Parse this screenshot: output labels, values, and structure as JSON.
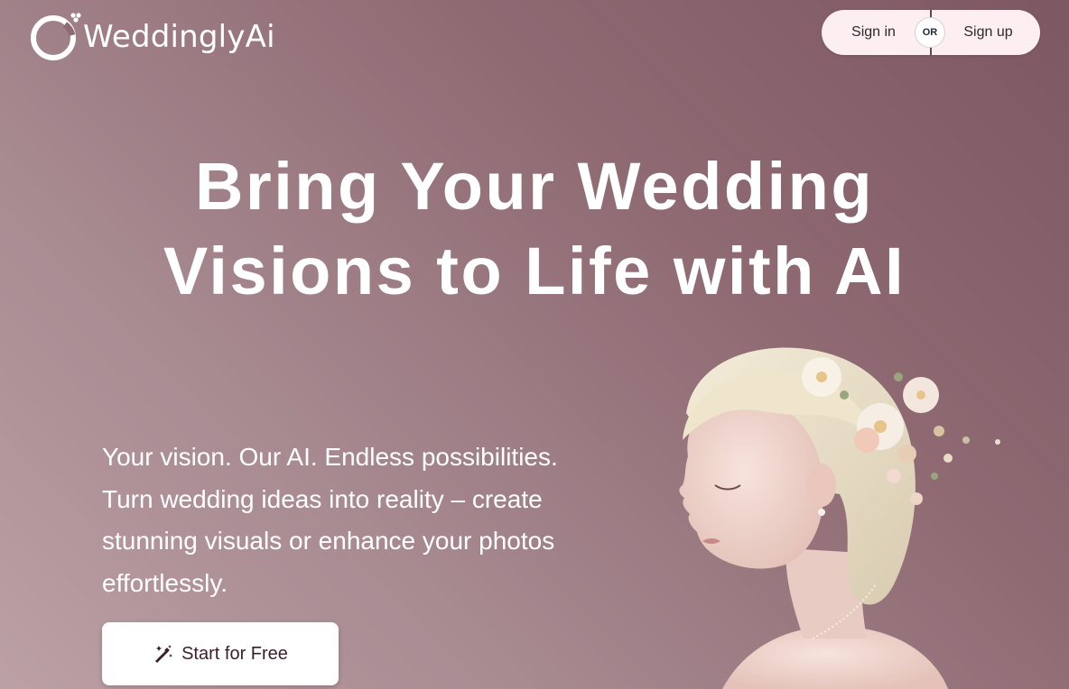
{
  "header": {
    "brand": "WeddinglyAi",
    "logo_icon": "ring-logo-icon",
    "sign_in_label": "Sign in",
    "or_label": "OR",
    "sign_up_label": "Sign up"
  },
  "hero": {
    "title_line1": "Bring Your Wedding",
    "title_line2": "Visions to Life with AI",
    "description": "Your vision. Our AI. Endless possibilities. Turn wedding ideas into reality – create stunning visuals or enhance your photos effortlessly.",
    "cta_label": "Start for Free",
    "cta_icon": "magic-wand-icon",
    "image": "bride-portrait-with-flowers"
  },
  "colors": {
    "background": "#8f6a73",
    "auth_pill": "#fdeff1",
    "cta_text": "#3a1f2b"
  }
}
